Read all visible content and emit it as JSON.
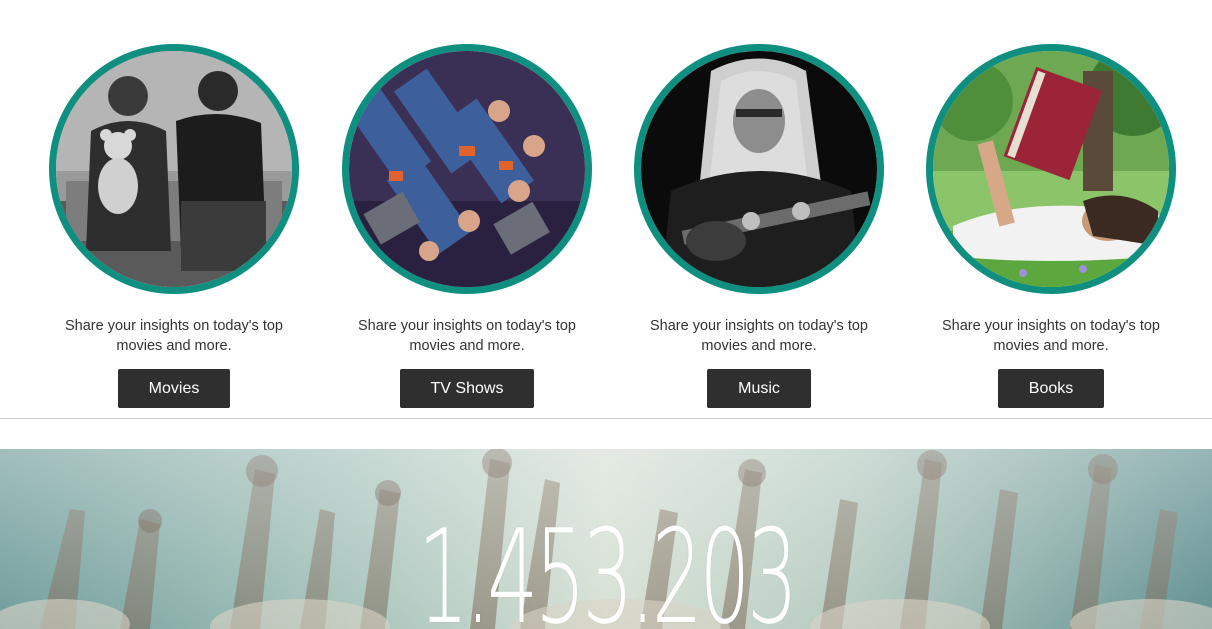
{
  "categories": [
    {
      "caption": "Share your insights on today's top movies and more.",
      "button_label": "Movies",
      "image_icon": "movies-photo"
    },
    {
      "caption": "Share your insights on today's top movies and more.",
      "button_label": "TV Shows",
      "image_icon": "tv-shows-photo"
    },
    {
      "caption": "Share your insights on today's top movies and more.",
      "button_label": "Music",
      "image_icon": "music-photo"
    },
    {
      "caption": "Share your insights on today's top movies and more.",
      "button_label": "Books",
      "image_icon": "books-photo"
    }
  ],
  "hero": {
    "counter": "1.453.203"
  },
  "colors": {
    "ring": "#0f8f80",
    "button": "#2f2f2f",
    "button_text": "#ffffff",
    "caption_text": "#333333"
  }
}
